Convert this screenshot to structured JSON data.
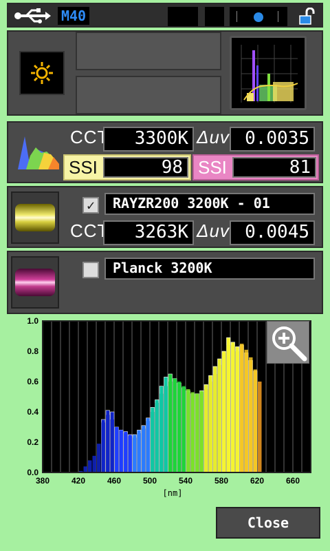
{
  "status": {
    "mode_badge": "M40"
  },
  "measure1": {
    "cct_label": "CCT",
    "cct_value": "3300K",
    "duv_label": "Δuv",
    "duv_value": "0.0035",
    "ssi_a_label": "SSI",
    "ssi_a_value": "98",
    "ssi_b_label": "SSI",
    "ssi_b_value": "81"
  },
  "reference1": {
    "checked": true,
    "check_glyph": "✓",
    "name": "RAYZR200 3200K - 01",
    "cct_label": "CCT",
    "cct_value": "3263K",
    "duv_label": "Δuv",
    "duv_value": "0.0045"
  },
  "reference2": {
    "checked": false,
    "name": "Planck 3200K"
  },
  "close_button": "Close",
  "icons": [
    "usb-icon",
    "sun-icon",
    "spectrum-thumb-icon",
    "lock-icon",
    "zoom-icon",
    "battery-icon"
  ],
  "colors": {
    "background": "#a6f0a0",
    "ssi_a": "#f7f3a6",
    "ssi_b": "#e986c4"
  },
  "chart_data": {
    "type": "bar",
    "xlabel": "[nm]",
    "ylabel": "",
    "xlim": [
      380,
      680
    ],
    "ylim": [
      0,
      1.0
    ],
    "x_ticks": [
      "380",
      "420",
      "460",
      "500",
      "540",
      "580",
      "620",
      "660"
    ],
    "y_ticks": [
      "0.0",
      "0.2",
      "0.4",
      "0.6",
      "0.8",
      "1.0"
    ],
    "grid": true,
    "series": [
      {
        "values": [
          {
            "x": 420,
            "y": 0.01
          },
          {
            "x": 425,
            "y": 0.04
          },
          {
            "x": 430,
            "y": 0.08
          },
          {
            "x": 435,
            "y": 0.11
          },
          {
            "x": 440,
            "y": 0.19
          },
          {
            "x": 445,
            "y": 0.33
          },
          {
            "x": 450,
            "y": 0.38
          },
          {
            "x": 455,
            "y": 0.35
          },
          {
            "x": 460,
            "y": 0.3
          },
          {
            "x": 465,
            "y": 0.28
          },
          {
            "x": 470,
            "y": 0.26
          },
          {
            "x": 475,
            "y": 0.24
          },
          {
            "x": 480,
            "y": 0.23
          },
          {
            "x": 485,
            "y": 0.26
          },
          {
            "x": 490,
            "y": 0.29
          },
          {
            "x": 495,
            "y": 0.34
          },
          {
            "x": 500,
            "y": 0.4
          },
          {
            "x": 505,
            "y": 0.46
          },
          {
            "x": 510,
            "y": 0.52
          },
          {
            "x": 515,
            "y": 0.57
          },
          {
            "x": 520,
            "y": 0.6
          },
          {
            "x": 525,
            "y": 0.62
          },
          {
            "x": 530,
            "y": 0.6
          },
          {
            "x": 535,
            "y": 0.57
          },
          {
            "x": 540,
            "y": 0.55
          },
          {
            "x": 545,
            "y": 0.53
          },
          {
            "x": 550,
            "y": 0.52
          },
          {
            "x": 555,
            "y": 0.53
          },
          {
            "x": 560,
            "y": 0.55
          },
          {
            "x": 565,
            "y": 0.6
          },
          {
            "x": 570,
            "y": 0.65
          },
          {
            "x": 575,
            "y": 0.71
          },
          {
            "x": 580,
            "y": 0.79
          },
          {
            "x": 585,
            "y": 0.84
          },
          {
            "x": 590,
            "y": 0.84
          },
          {
            "x": 595,
            "y": 0.8
          },
          {
            "x": 600,
            "y": 0.85
          },
          {
            "x": 605,
            "y": 0.81
          },
          {
            "x": 610,
            "y": 0.76
          },
          {
            "x": 615,
            "y": 0.68
          },
          {
            "x": 620,
            "y": 0.6
          }
        ]
      },
      {
        "values": [
          {
            "x": 445,
            "y": 0.35
          },
          {
            "x": 450,
            "y": 0.41
          },
          {
            "x": 455,
            "y": 0.4
          },
          {
            "x": 460,
            "y": 0.3
          },
          {
            "x": 465,
            "y": 0.28
          },
          {
            "x": 470,
            "y": 0.27
          },
          {
            "x": 475,
            "y": 0.25
          },
          {
            "x": 480,
            "y": 0.25
          },
          {
            "x": 485,
            "y": 0.28
          },
          {
            "x": 490,
            "y": 0.31
          },
          {
            "x": 495,
            "y": 0.36
          },
          {
            "x": 500,
            "y": 0.43
          },
          {
            "x": 505,
            "y": 0.48
          },
          {
            "x": 510,
            "y": 0.57
          },
          {
            "x": 515,
            "y": 0.63
          },
          {
            "x": 520,
            "y": 0.65
          },
          {
            "x": 525,
            "y": 0.62
          },
          {
            "x": 530,
            "y": 0.59
          },
          {
            "x": 535,
            "y": 0.56
          },
          {
            "x": 540,
            "y": 0.54
          },
          {
            "x": 545,
            "y": 0.52
          },
          {
            "x": 550,
            "y": 0.52
          },
          {
            "x": 555,
            "y": 0.54
          },
          {
            "x": 560,
            "y": 0.58
          },
          {
            "x": 565,
            "y": 0.64
          },
          {
            "x": 570,
            "y": 0.7
          },
          {
            "x": 575,
            "y": 0.75
          },
          {
            "x": 580,
            "y": 0.8
          },
          {
            "x": 585,
            "y": 0.89
          },
          {
            "x": 590,
            "y": 0.86
          },
          {
            "x": 595,
            "y": 0.83
          },
          {
            "x": 600,
            "y": 0.84
          },
          {
            "x": 605,
            "y": 0.79
          },
          {
            "x": 610,
            "y": 0.74
          },
          {
            "x": 615,
            "y": 0.67
          }
        ]
      }
    ]
  }
}
